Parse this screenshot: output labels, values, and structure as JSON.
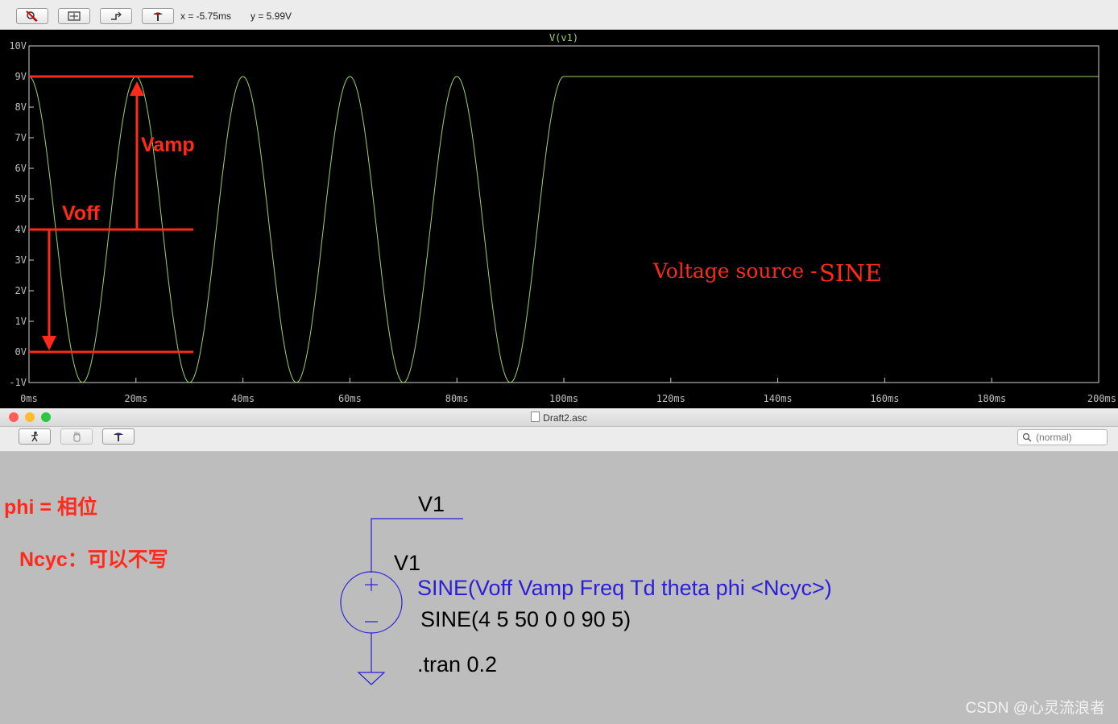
{
  "wave_toolbar": {
    "readout_x": "x = -5.75ms",
    "readout_y": "y = 5.99V"
  },
  "plot": {
    "trace_name": "V(v1)",
    "y_ticks": [
      "10V",
      "9V",
      "8V",
      "7V",
      "6V",
      "5V",
      "4V",
      "3V",
      "2V",
      "1V",
      "0V",
      "-1V"
    ],
    "x_ticks": [
      "0ms",
      "20ms",
      "40ms",
      "60ms",
      "80ms",
      "100ms",
      "120ms",
      "140ms",
      "160ms",
      "180ms",
      "200ms"
    ],
    "trace_color": "#9bd36a"
  },
  "chart_data": {
    "type": "line",
    "title": "V(v1)",
    "xlabel": "",
    "ylabel": "",
    "xlim": [
      0,
      200
    ],
    "ylim": [
      -1,
      10
    ],
    "x_unit": "ms",
    "y_unit": "V",
    "grid": false,
    "series": [
      {
        "name": "V(v1)",
        "color": "#9bd36a",
        "x": [
          0,
          10,
          20,
          30,
          40,
          50,
          60,
          70,
          80,
          90,
          100,
          200
        ],
        "y": [
          9,
          -1,
          9,
          -1,
          9,
          -1,
          9,
          -1,
          9,
          -1,
          9,
          9
        ]
      }
    ]
  },
  "annotations": {
    "vamp": "Vamp",
    "voff": "Voff",
    "title_prefix": "Voltage source -",
    "title_main": "SINE",
    "phi": "phi = 相位",
    "ncyc": "Ncyc：可以不写",
    "color": "#ff2a1a"
  },
  "schematic_window": {
    "title": "Draft2.asc",
    "search_placeholder": "(normal)"
  },
  "schematic": {
    "net_label": "V1",
    "component_name": "V1",
    "syntax": "SINE(Voff Vamp Freq Td theta phi <Ncyc>)",
    "value": "SINE(4 5 50 0 0 90 5)",
    "directive": ".tran 0.2",
    "wire_color": "#2a1fd6"
  },
  "watermark": "CSDN @心灵流浪者"
}
